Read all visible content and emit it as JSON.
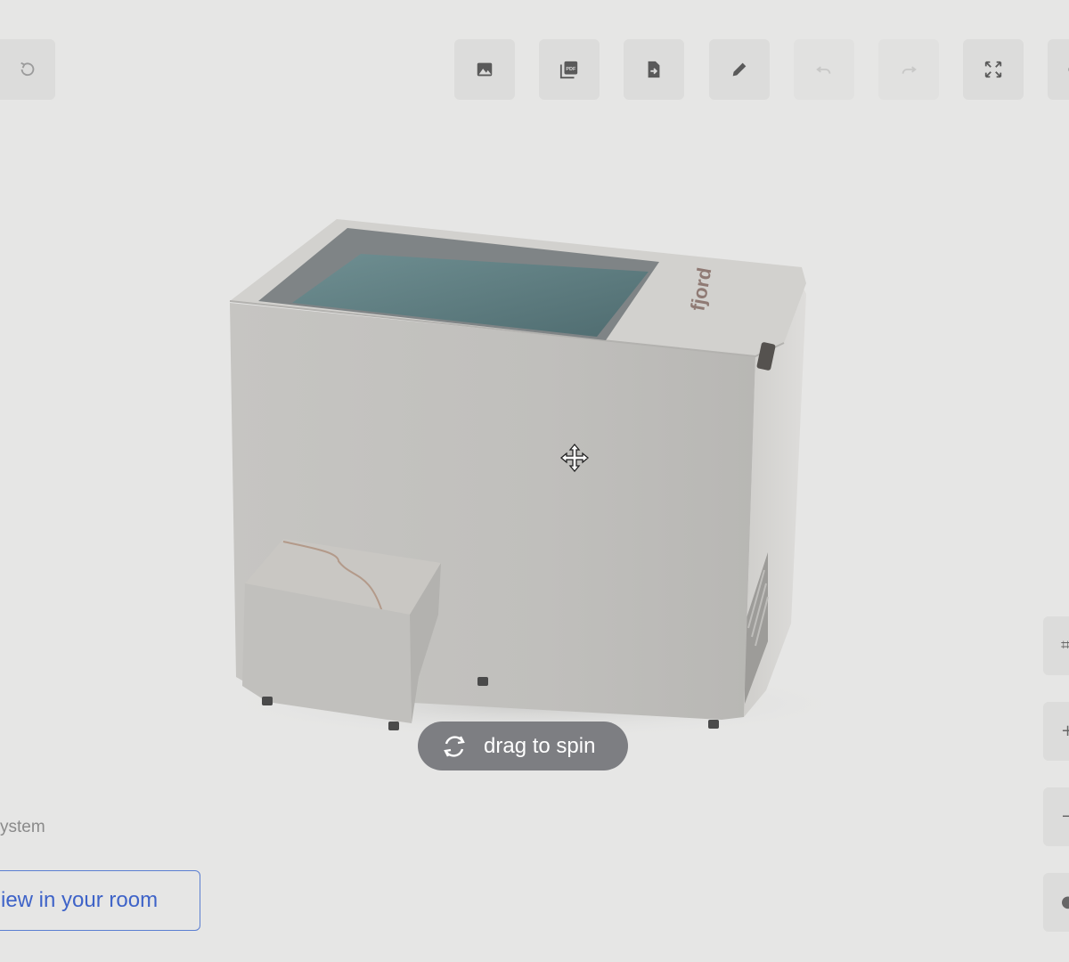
{
  "toolbar": {
    "reset_icon": "reset-rotate-icon",
    "buttons": [
      {
        "name": "image-button",
        "icon": "image-icon",
        "enabled": true
      },
      {
        "name": "pdf-button",
        "icon": "pdf-icon",
        "label": "PDF",
        "enabled": true
      },
      {
        "name": "export-button",
        "icon": "file-export-icon",
        "enabled": true
      },
      {
        "name": "edit-button",
        "icon": "pencil-icon",
        "enabled": true
      },
      {
        "name": "undo-button",
        "icon": "undo-icon",
        "enabled": false
      },
      {
        "name": "redo-button",
        "icon": "redo-icon",
        "enabled": false
      },
      {
        "name": "fullscreen-button",
        "icon": "fullscreen-icon",
        "enabled": true
      }
    ]
  },
  "viewer": {
    "product_brand": "fjord",
    "spin_hint": "drag to spin",
    "cursor": "move-cursor-icon"
  },
  "sidebar": {
    "system_label": "ystem",
    "view_room_label": "iew in your room"
  },
  "colors": {
    "background": "#e6e6e5",
    "pill": "#7d7e82",
    "link": "#3e63c8",
    "tub_body": "#c2c1be",
    "water": "#5f7f83"
  }
}
